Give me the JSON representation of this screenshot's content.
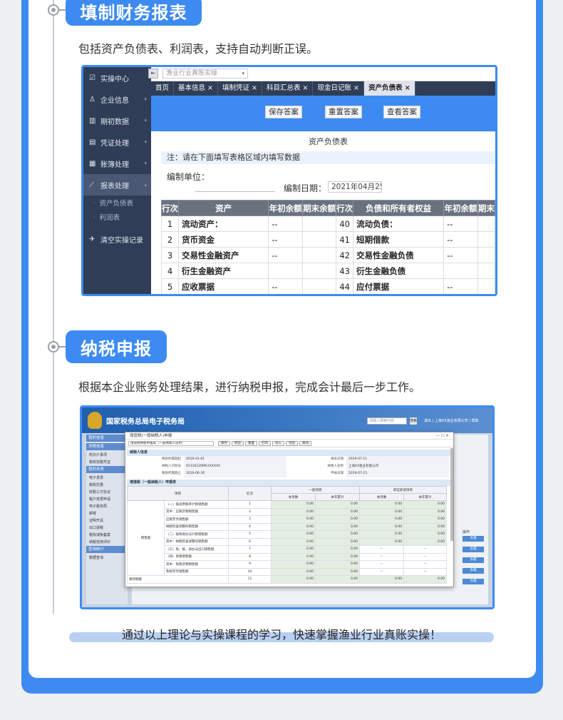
{
  "section1": {
    "title": "填制财务报表",
    "description": "包括资产负债表、利润表，支持自动判断正误。"
  },
  "shot1": {
    "sidebar": {
      "items": [
        {
          "label": "实操中心",
          "icon": "clipboard-icon"
        },
        {
          "label": "企业信息",
          "icon": "users-icon"
        },
        {
          "label": "期初数据",
          "icon": "bar-chart-icon"
        },
        {
          "label": "凭证处理",
          "icon": "document-icon"
        },
        {
          "label": "账簿处理",
          "icon": "book-icon"
        },
        {
          "label": "报表处理",
          "icon": "line-chart-icon"
        }
      ],
      "subitems": [
        "资产负债表",
        "利润表"
      ],
      "clear_label": "清空实操记录"
    },
    "course_select": "渔业行业真账实操",
    "tabs": [
      "首页",
      "基本信息 ×",
      "填制凭证 ×",
      "科目汇总表 ×",
      "现金日记账 ×",
      "资产负债表 ×"
    ],
    "buttons": {
      "save": "保存答案",
      "reset": "重置答案",
      "view": "查看答案"
    },
    "report_title": "资产负债表",
    "note": "注：请在下面填写表格区域内填写数据",
    "unit_label": "编制单位：",
    "date_label": "编制日期：",
    "date_value": "2021年04月25",
    "table": {
      "headers": [
        "行次",
        "资产",
        "年初余额",
        "期末余额",
        "行次",
        "负债和所有者权益",
        "年初余额",
        "期末"
      ],
      "rows": [
        [
          "1",
          "流动资产：",
          "--",
          "",
          "40",
          "流动负债：",
          "--",
          ""
        ],
        [
          "2",
          "货币资金",
          "--",
          "",
          "41",
          "短期借款",
          "--",
          ""
        ],
        [
          "3",
          "交易性金融资产",
          "--",
          "",
          "42",
          "交易性金融负债",
          "--",
          ""
        ],
        [
          "4",
          "衍生金融资产",
          "",
          "",
          "43",
          "衍生金融负债",
          "",
          ""
        ],
        [
          "5",
          "应收票据",
          "--",
          "",
          "44",
          "应付票据",
          "--",
          ""
        ]
      ]
    }
  },
  "section2": {
    "title": "纳税申报",
    "description": "根据本企业账务处理结果，进行纳税申报，完成会计最后一步工作。"
  },
  "shot2": {
    "header_title": "国家税务总局电子税务局",
    "search_placeholder": "请输入搜索内容",
    "search_button": "搜索",
    "header_links": "退出 | 上海XX渔业有限公司 | 帮助",
    "sidebar_groups": [
      {
        "label": "我的信息",
        "items": []
      },
      {
        "label": "涉税信息",
        "items": [
          "所办户事项",
          "税收完税凭证"
        ]
      },
      {
        "label": "我的业务",
        "items": [
          "电子发票",
          "税收优惠",
          "财税三方协议",
          "税户变更申请",
          "电子税务局",
          "邮寄",
          "证明开具",
          "出口退税",
          "税收减免备案",
          "纳税信用评价"
        ]
      },
      {
        "label": "查询统计",
        "items": [
          "数据查询"
        ]
      }
    ],
    "right_head": "操作",
    "right_buttons": [
      "办理",
      "办理",
      "办理",
      "办理",
      "办理"
    ],
    "modal": {
      "title": "增值税(一般纳税人)申报",
      "controls": "— ☐ ✕",
      "select": "增值税纳税申报表（一般纳税人适用）",
      "toolbar": [
        "保存",
        "校验",
        "重置",
        "打印",
        "导入",
        "导出",
        "关闭"
      ],
      "section_info": "纳税人信息",
      "info_rows": [
        [
          {
            "label": "税款所属期起",
            "value": "2019-01-01"
          },
          {
            "label": "填表日期",
            "value": "2019-07-11"
          }
        ],
        [
          {
            "label": "纳税人识别号",
            "value": "91310120MA1XXXXX"
          },
          {
            "label": "纳税人名称",
            "value": "上海XX渔业有限公司"
          }
        ],
        [
          {
            "label": "税款所属期止",
            "value": "2019-06-30"
          },
          {
            "label": "申报日期",
            "value": "2019-07-15"
          }
        ]
      ],
      "section_table": "增值税（一般纳税人）申报表",
      "table_headers": [
        "项目",
        "栏次",
        "一般项目",
        "即征即退项目"
      ],
      "table_subheaders": [
        "本月数",
        "本年累计",
        "本月数",
        "本年累计"
      ],
      "row_group": "销售额",
      "rows": [
        {
          "label": "（一）按适用税率计税销售额",
          "no": "1",
          "vals": [
            "0.00",
            "0.00",
            "0.00",
            "0.00"
          ]
        },
        {
          "label": "其中：应税货物销售额",
          "no": "2",
          "vals": [
            "0.00",
            "0.00",
            "0.00",
            "0.00"
          ]
        },
        {
          "label": "应税劳务销售额",
          "no": "3",
          "vals": [
            "0.00",
            "0.00",
            "0.00",
            "0.00"
          ]
        },
        {
          "label": "纳税检查调整的销售额",
          "no": "4",
          "vals": [
            "0.00",
            "0.00",
            "0.00",
            "0.00"
          ]
        },
        {
          "label": "（二）按简易办法计税销售额",
          "no": "5",
          "vals": [
            "0.00",
            "0.00",
            "0.00",
            "0.00"
          ]
        },
        {
          "label": "其中：纳税检查调整的销售额",
          "no": "6",
          "vals": [
            "0.00",
            "0.00",
            "0.00",
            "0.00"
          ]
        },
        {
          "label": "（三）免、抵、退办法出口销售额",
          "no": "7",
          "vals": [
            "0.00",
            "0.00",
            "--",
            "--"
          ]
        },
        {
          "label": "（四）免税销售额",
          "no": "8",
          "vals": [
            "0.00",
            "0.00",
            "--",
            "--"
          ]
        },
        {
          "label": "其中：免税货物销售额",
          "no": "9",
          "vals": [
            "0.00",
            "0.00",
            "--",
            "--"
          ]
        },
        {
          "label": "免税劳务销售额",
          "no": "10",
          "vals": [
            "0.00",
            "0.00",
            "--",
            "--"
          ]
        },
        {
          "label": "销项税额",
          "no": "11",
          "vals": [
            "0.00",
            "0.00",
            "0.00",
            "0.00"
          ]
        }
      ]
    }
  },
  "footer": "通过以上理论与实操课程的学习，快速掌握渔业行业真账实操！",
  "colors": {
    "accent": "#3d8bf2",
    "sidebar_dark": "#2f3e56",
    "footer_band": "#b9d0f3"
  }
}
